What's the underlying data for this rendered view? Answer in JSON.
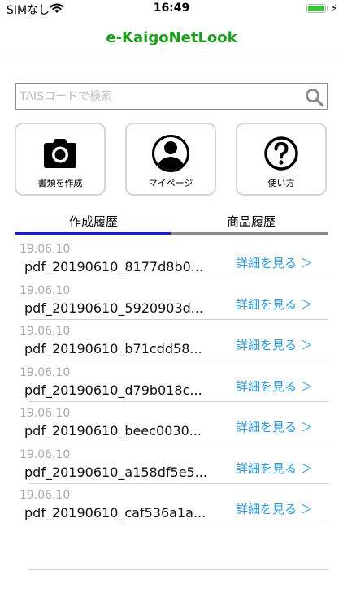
{
  "status_bar": {
    "carrier": "SIMなし",
    "time": "16:49"
  },
  "nav": {
    "title": "e-KaigoNetLook"
  },
  "search": {
    "placeholder": "TAISコードで検索"
  },
  "actions": [
    {
      "label": "書類を作成",
      "icon": "camera-icon"
    },
    {
      "label": "マイページ",
      "icon": "person-icon"
    },
    {
      "label": "使い方",
      "icon": "help-icon"
    }
  ],
  "tabs": [
    {
      "label": "作成履歴",
      "active": true
    },
    {
      "label": "商品履歴",
      "active": false
    }
  ],
  "history": [
    {
      "date": "19.06.10",
      "file": "pdf_20190610_8177d8b0...",
      "link": "詳細を見る ＞"
    },
    {
      "date": "19.06.10",
      "file": "pdf_20190610_5920903d...",
      "link": "詳細を見る ＞"
    },
    {
      "date": "19.06.10",
      "file": "pdf_20190610_b71cdd58...",
      "link": "詳細を見る ＞"
    },
    {
      "date": "19.06.10",
      "file": "pdf_20190610_d79b018c...",
      "link": "詳細を見る ＞"
    },
    {
      "date": "19.06.10",
      "file": "pdf_20190610_beec0030...",
      "link": "詳細を見る ＞"
    },
    {
      "date": "19.06.10",
      "file": "pdf_20190610_a158df5e5...",
      "link": "詳細を見る ＞"
    },
    {
      "date": "19.06.10",
      "file": "pdf_20190610_caf536a1a...",
      "link": "詳細を見る ＞"
    }
  ],
  "colors": {
    "title_green": "#1f9d1f",
    "link_blue": "#2d9ad9",
    "tab_active": "#1b1bd6",
    "tab_inactive": "#8a8a8a",
    "battery_green": "#3bc43b"
  }
}
